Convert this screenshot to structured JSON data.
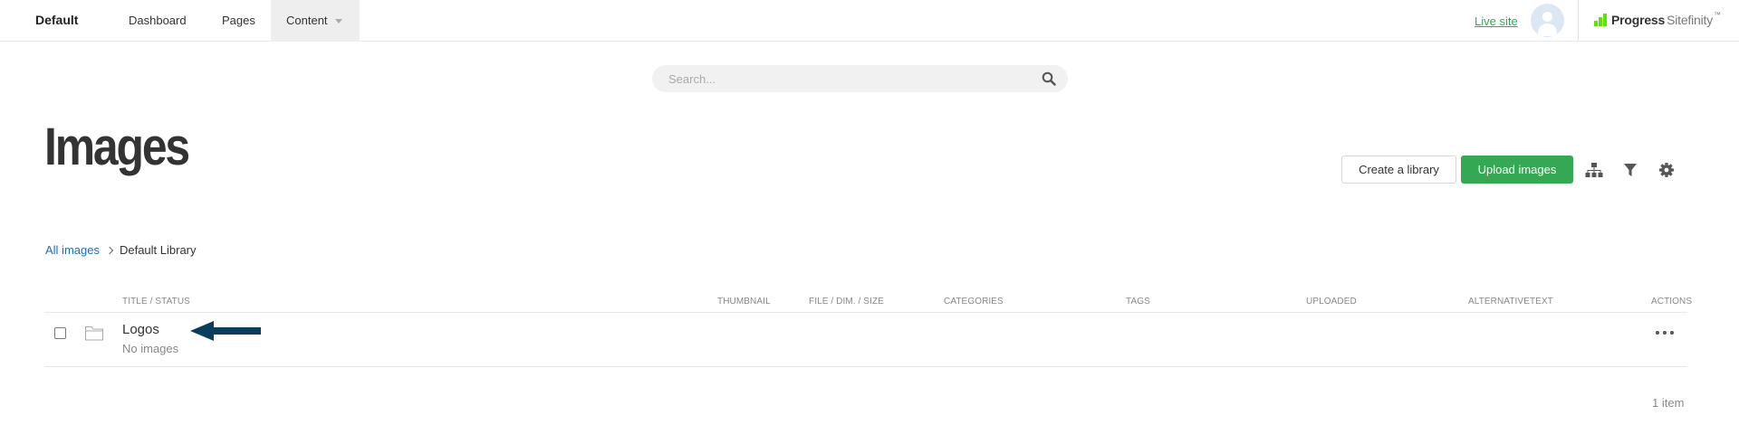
{
  "topbar": {
    "site_name": "Default",
    "nav": [
      {
        "label": "Dashboard"
      },
      {
        "label": "Pages"
      },
      {
        "label": "Content"
      }
    ],
    "live_site": "Live site",
    "brand_name": "Progress",
    "brand_product": "Sitefinity",
    "brand_trademark": "™",
    "brand_color": "#5ce500"
  },
  "search": {
    "placeholder": "Search...",
    "value": "",
    "icon": "search-icon"
  },
  "page": {
    "title": "Images"
  },
  "toolbar": {
    "create_label": "Create a library",
    "upload_label": "Upload images",
    "accent_color": "#35a853",
    "icons": [
      "hierarchy-icon",
      "filter-icon",
      "gear-icon"
    ]
  },
  "breadcrumb": {
    "root": "All images",
    "current": "Default Library"
  },
  "table": {
    "columns": [
      "TITLE / STATUS",
      "THUMBNAIL",
      "FILE / DIM. / SIZE",
      "CATEGORIES",
      "TAGS",
      "UPLOADED",
      "ALTERNATIVETEXT",
      "ACTIONS"
    ],
    "rows": [
      {
        "title": "Logos",
        "status": "No images",
        "icon": "folder-icon",
        "checked": false
      }
    ]
  },
  "footer": {
    "count": "1 item"
  }
}
